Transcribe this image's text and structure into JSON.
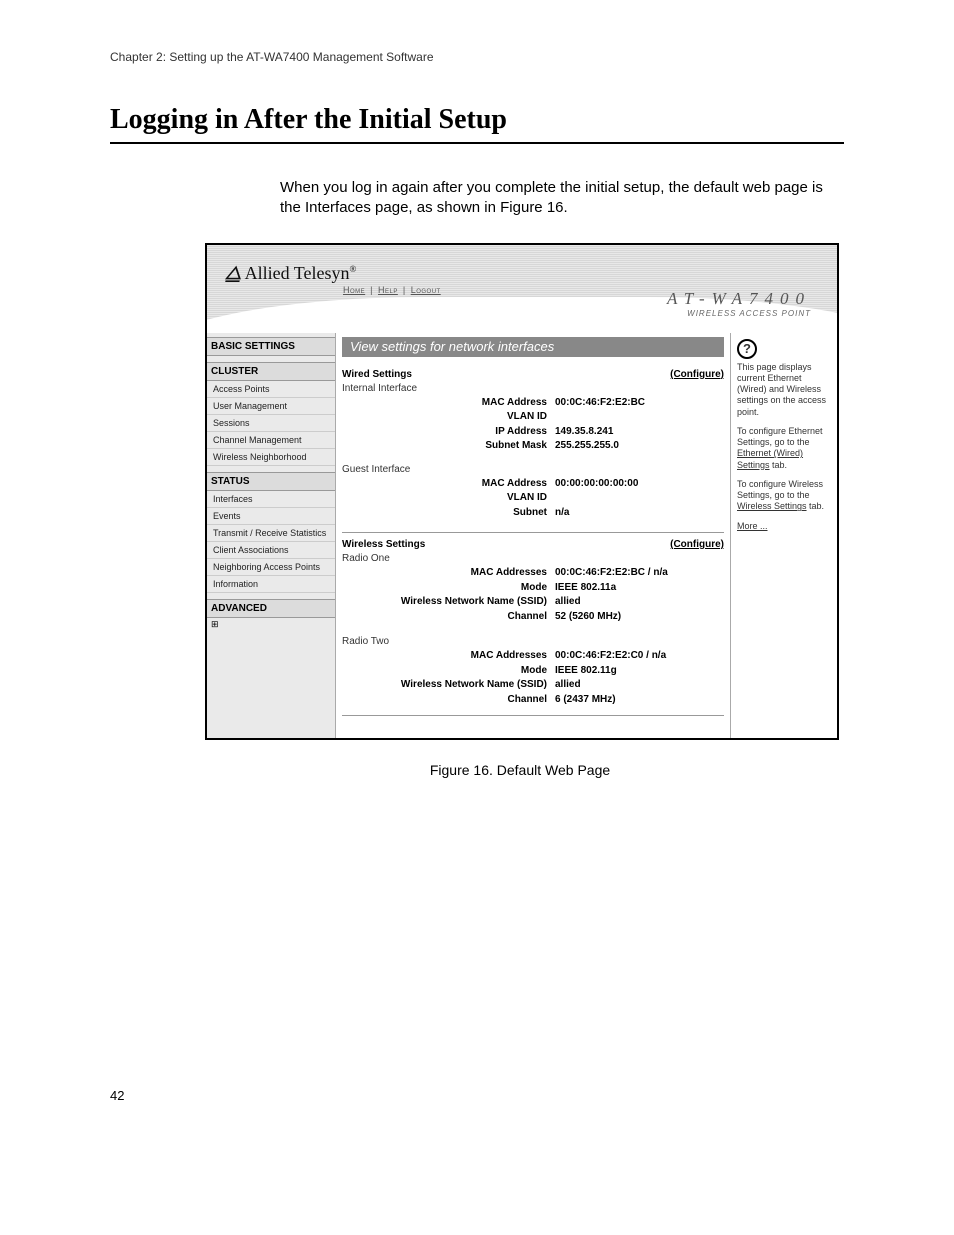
{
  "chapter_line": "Chapter 2: Setting up the AT-WA7400 Management Software",
  "section_title": "Logging in After the Initial Setup",
  "intro_text": "When you log in again after you complete the initial setup, the default web page is the Interfaces page, as shown in Figure 16.",
  "brand": "Allied Telesyn",
  "hdr_links": {
    "home": "Home",
    "help": "Help",
    "logout": "Logout"
  },
  "device_title": "AT-WA7400",
  "device_sub": "WIRELESS ACCESS POINT",
  "sidebar": {
    "basic": "BASIC SETTINGS",
    "cluster": "CLUSTER",
    "cluster_items": [
      "Access Points",
      "User Management",
      "Sessions",
      "Channel Management",
      "Wireless Neighborhood"
    ],
    "status": "STATUS",
    "status_items": [
      "Interfaces",
      "Events",
      "Transmit / Receive Statistics",
      "Client Associations",
      "Neighboring Access Points",
      "Information"
    ],
    "advanced": "ADVANCED"
  },
  "panel_title": "View settings for network interfaces",
  "wired": {
    "heading": "Wired Settings",
    "configure": "(Configure)",
    "internal_h": "Internal Interface",
    "internal": {
      "mac_k": "MAC Address",
      "mac_v": "00:0C:46:F2:E2:BC",
      "vlan_k": "VLAN ID",
      "vlan_v": "",
      "ip_k": "IP Address",
      "ip_v": "149.35.8.241",
      "mask_k": "Subnet Mask",
      "mask_v": "255.255.255.0"
    },
    "guest_h": "Guest Interface",
    "guest": {
      "mac_k": "MAC Address",
      "mac_v": "00:00:00:00:00:00",
      "vlan_k": "VLAN ID",
      "vlan_v": "",
      "sub_k": "Subnet",
      "sub_v": "n/a"
    }
  },
  "wireless": {
    "heading": "Wireless Settings",
    "configure": "(Configure)",
    "radio1_h": "Radio One",
    "radio1": {
      "mac_k": "MAC Addresses",
      "mac_v": "00:0C:46:F2:E2:BC / n/a",
      "mode_k": "Mode",
      "mode_v": "IEEE 802.11a",
      "ssid_k": "Wireless Network Name (SSID)",
      "ssid_v": "allied",
      "ch_k": "Channel",
      "ch_v": "52 (5260 MHz)"
    },
    "radio2_h": "Radio Two",
    "radio2": {
      "mac_k": "MAC Addresses",
      "mac_v": "00:0C:46:F2:E2:C0 / n/a",
      "mode_k": "Mode",
      "mode_v": "IEEE 802.11g",
      "ssid_k": "Wireless Network Name (SSID)",
      "ssid_v": "allied",
      "ch_k": "Channel",
      "ch_v": "6 (2437 MHz)"
    }
  },
  "help": {
    "p1": "This page displays current Ethernet (Wired) and Wireless settings on the access point.",
    "p2a": "To configure Ethernet Settings, go to the ",
    "p2link": "Ethernet (Wired) Settings",
    "p2b": " tab.",
    "p3a": "To configure Wireless Settings, go to the ",
    "p3link": "Wireless Settings",
    "p3b": " tab.",
    "more": "More ..."
  },
  "figure_caption": "Figure 16. Default Web Page",
  "page_number": "42"
}
